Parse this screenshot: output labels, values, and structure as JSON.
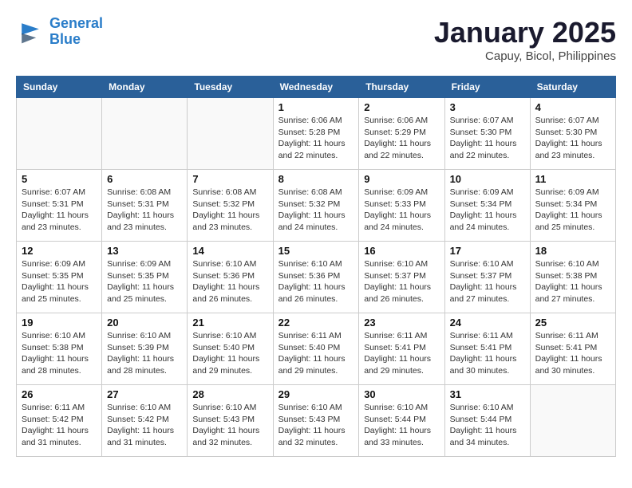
{
  "header": {
    "logo_line1": "General",
    "logo_line2": "Blue",
    "month": "January 2025",
    "location": "Capuy, Bicol, Philippines"
  },
  "weekdays": [
    "Sunday",
    "Monday",
    "Tuesday",
    "Wednesday",
    "Thursday",
    "Friday",
    "Saturday"
  ],
  "weeks": [
    [
      {
        "day": "",
        "info": ""
      },
      {
        "day": "",
        "info": ""
      },
      {
        "day": "",
        "info": ""
      },
      {
        "day": "1",
        "info": "Sunrise: 6:06 AM\nSunset: 5:28 PM\nDaylight: 11 hours\nand 22 minutes."
      },
      {
        "day": "2",
        "info": "Sunrise: 6:06 AM\nSunset: 5:29 PM\nDaylight: 11 hours\nand 22 minutes."
      },
      {
        "day": "3",
        "info": "Sunrise: 6:07 AM\nSunset: 5:30 PM\nDaylight: 11 hours\nand 22 minutes."
      },
      {
        "day": "4",
        "info": "Sunrise: 6:07 AM\nSunset: 5:30 PM\nDaylight: 11 hours\nand 23 minutes."
      }
    ],
    [
      {
        "day": "5",
        "info": "Sunrise: 6:07 AM\nSunset: 5:31 PM\nDaylight: 11 hours\nand 23 minutes."
      },
      {
        "day": "6",
        "info": "Sunrise: 6:08 AM\nSunset: 5:31 PM\nDaylight: 11 hours\nand 23 minutes."
      },
      {
        "day": "7",
        "info": "Sunrise: 6:08 AM\nSunset: 5:32 PM\nDaylight: 11 hours\nand 23 minutes."
      },
      {
        "day": "8",
        "info": "Sunrise: 6:08 AM\nSunset: 5:32 PM\nDaylight: 11 hours\nand 24 minutes."
      },
      {
        "day": "9",
        "info": "Sunrise: 6:09 AM\nSunset: 5:33 PM\nDaylight: 11 hours\nand 24 minutes."
      },
      {
        "day": "10",
        "info": "Sunrise: 6:09 AM\nSunset: 5:34 PM\nDaylight: 11 hours\nand 24 minutes."
      },
      {
        "day": "11",
        "info": "Sunrise: 6:09 AM\nSunset: 5:34 PM\nDaylight: 11 hours\nand 25 minutes."
      }
    ],
    [
      {
        "day": "12",
        "info": "Sunrise: 6:09 AM\nSunset: 5:35 PM\nDaylight: 11 hours\nand 25 minutes."
      },
      {
        "day": "13",
        "info": "Sunrise: 6:09 AM\nSunset: 5:35 PM\nDaylight: 11 hours\nand 25 minutes."
      },
      {
        "day": "14",
        "info": "Sunrise: 6:10 AM\nSunset: 5:36 PM\nDaylight: 11 hours\nand 26 minutes."
      },
      {
        "day": "15",
        "info": "Sunrise: 6:10 AM\nSunset: 5:36 PM\nDaylight: 11 hours\nand 26 minutes."
      },
      {
        "day": "16",
        "info": "Sunrise: 6:10 AM\nSunset: 5:37 PM\nDaylight: 11 hours\nand 26 minutes."
      },
      {
        "day": "17",
        "info": "Sunrise: 6:10 AM\nSunset: 5:37 PM\nDaylight: 11 hours\nand 27 minutes."
      },
      {
        "day": "18",
        "info": "Sunrise: 6:10 AM\nSunset: 5:38 PM\nDaylight: 11 hours\nand 27 minutes."
      }
    ],
    [
      {
        "day": "19",
        "info": "Sunrise: 6:10 AM\nSunset: 5:38 PM\nDaylight: 11 hours\nand 28 minutes."
      },
      {
        "day": "20",
        "info": "Sunrise: 6:10 AM\nSunset: 5:39 PM\nDaylight: 11 hours\nand 28 minutes."
      },
      {
        "day": "21",
        "info": "Sunrise: 6:10 AM\nSunset: 5:40 PM\nDaylight: 11 hours\nand 29 minutes."
      },
      {
        "day": "22",
        "info": "Sunrise: 6:11 AM\nSunset: 5:40 PM\nDaylight: 11 hours\nand 29 minutes."
      },
      {
        "day": "23",
        "info": "Sunrise: 6:11 AM\nSunset: 5:41 PM\nDaylight: 11 hours\nand 29 minutes."
      },
      {
        "day": "24",
        "info": "Sunrise: 6:11 AM\nSunset: 5:41 PM\nDaylight: 11 hours\nand 30 minutes."
      },
      {
        "day": "25",
        "info": "Sunrise: 6:11 AM\nSunset: 5:41 PM\nDaylight: 11 hours\nand 30 minutes."
      }
    ],
    [
      {
        "day": "26",
        "info": "Sunrise: 6:11 AM\nSunset: 5:42 PM\nDaylight: 11 hours\nand 31 minutes."
      },
      {
        "day": "27",
        "info": "Sunrise: 6:10 AM\nSunset: 5:42 PM\nDaylight: 11 hours\nand 31 minutes."
      },
      {
        "day": "28",
        "info": "Sunrise: 6:10 AM\nSunset: 5:43 PM\nDaylight: 11 hours\nand 32 minutes."
      },
      {
        "day": "29",
        "info": "Sunrise: 6:10 AM\nSunset: 5:43 PM\nDaylight: 11 hours\nand 32 minutes."
      },
      {
        "day": "30",
        "info": "Sunrise: 6:10 AM\nSunset: 5:44 PM\nDaylight: 11 hours\nand 33 minutes."
      },
      {
        "day": "31",
        "info": "Sunrise: 6:10 AM\nSunset: 5:44 PM\nDaylight: 11 hours\nand 34 minutes."
      },
      {
        "day": "",
        "info": ""
      }
    ]
  ]
}
